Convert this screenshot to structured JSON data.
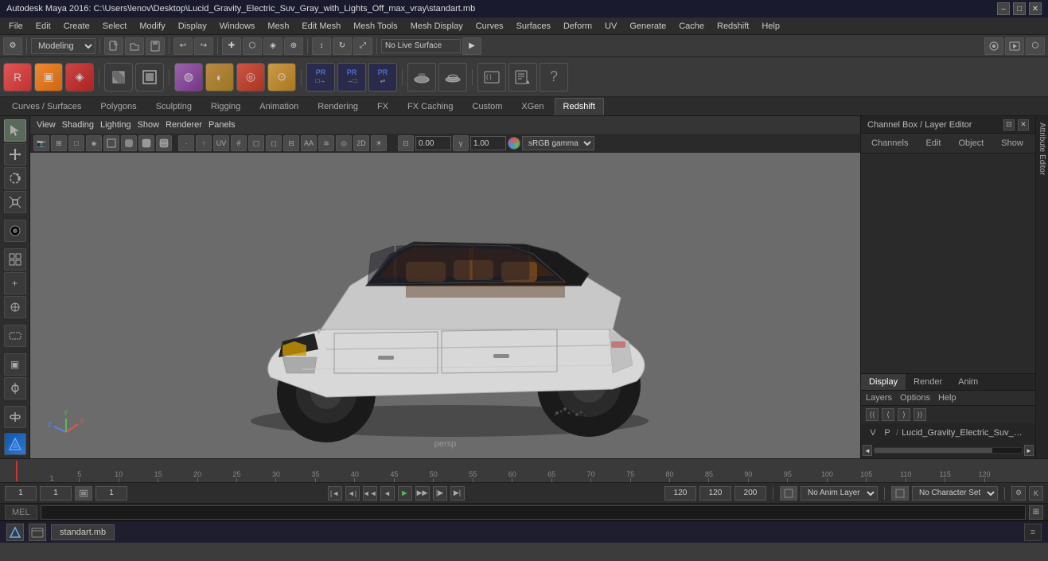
{
  "titlebar": {
    "title": "Autodesk Maya 2016: C:\\Users\\lenov\\Desktop\\Lucid_Gravity_Electric_Suv_Gray_with_Lights_Off_max_vray\\standart.mb",
    "min": "–",
    "max": "□",
    "close": "✕"
  },
  "menubar": {
    "items": [
      "File",
      "Edit",
      "Create",
      "Select",
      "Modify",
      "Display",
      "Windows",
      "Mesh",
      "Edit Mesh",
      "Mesh Tools",
      "Mesh Display",
      "Curves",
      "Surfaces",
      "Deform",
      "UV",
      "Generate",
      "Cache",
      "Redshift",
      "Help"
    ]
  },
  "mode_bar": {
    "mode": "Modeling",
    "dropdown_arrow": "▼"
  },
  "tabs": {
    "items": [
      "Curves / Surfaces",
      "Polygons",
      "Sculpting",
      "Rigging",
      "Animation",
      "Rendering",
      "FX",
      "FX Caching",
      "Custom",
      "XGen",
      "Redshift"
    ],
    "active": "Redshift"
  },
  "viewport": {
    "menus": [
      "View",
      "Shading",
      "Lighting",
      "Show",
      "Renderer",
      "Panels"
    ],
    "camera_label": "persp",
    "color_profile": "sRGB gamma",
    "zoom_value": "0.00",
    "second_value": "1.00"
  },
  "channel_box": {
    "title": "Channel Box / Layer Editor",
    "tabs": {
      "channels": "Channels",
      "edit": "Edit",
      "object": "Object",
      "show": "Show"
    },
    "layer_tabs": [
      "Display",
      "Render",
      "Anim"
    ],
    "active_layer_tab": "Display",
    "layer_menus": [
      "Layers",
      "Options",
      "Help"
    ],
    "layer_row": {
      "v": "V",
      "p": "P",
      "path": "/",
      "name": "Lucid_Gravity_Electric_Suv_Gray..."
    }
  },
  "timeline": {
    "ticks": [
      1,
      5,
      10,
      15,
      20,
      25,
      30,
      35,
      40,
      45,
      50,
      55,
      60,
      65,
      70,
      75,
      80,
      85,
      90,
      95,
      100,
      105,
      110,
      115,
      120
    ]
  },
  "bottom_controls": {
    "start_frame": "1",
    "current_frame_1": "1",
    "frame_indicator": "1",
    "end_key": "120",
    "end_frame": "120",
    "max_frame": "200",
    "anim_layer": "No Anim Layer",
    "char_set": "No Character Set"
  },
  "mel_bar": {
    "label": "MEL",
    "placeholder": ""
  },
  "taskbar": {
    "item1": "standart.mb",
    "icon_btn": "≡"
  },
  "axis": {
    "x_color": "#e05555",
    "y_color": "#55bb55",
    "z_color": "#5588ee"
  },
  "sidebar_label": {
    "attribute_editor": "Attribute Editor",
    "channel_box": "Channel Box / Layer Editor"
  }
}
